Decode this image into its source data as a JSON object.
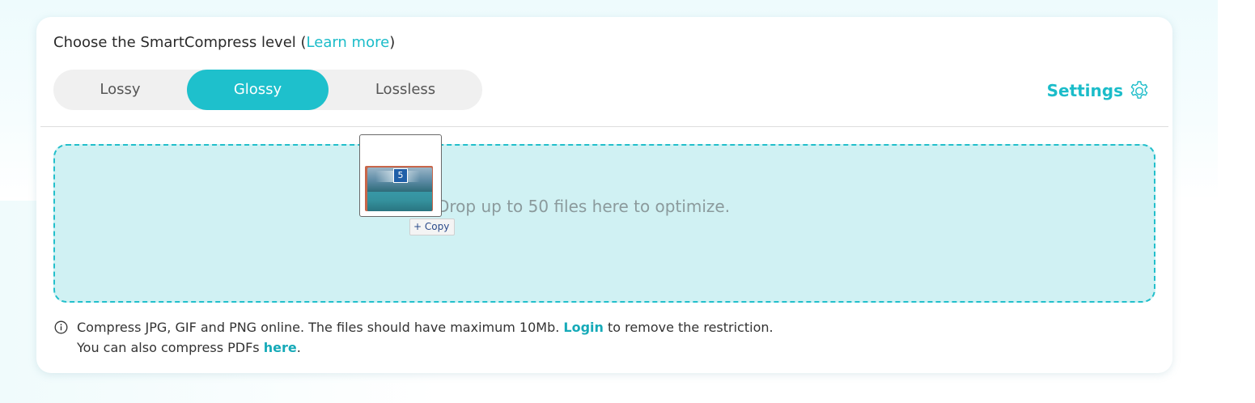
{
  "compress_level": {
    "title_prefix": "Choose the SmartCompress level (",
    "learn_more": "Learn more",
    "title_suffix": ")",
    "options": [
      {
        "label": "Lossy",
        "selected": false
      },
      {
        "label": "Glossy",
        "selected": true
      },
      {
        "label": "Lossless",
        "selected": false
      }
    ]
  },
  "settings": {
    "label": "Settings",
    "icon": "gear-icon"
  },
  "dropzone": {
    "text": "Drop up to 50 files here to optimize.",
    "drag_badge_count": "5",
    "copy_tooltip": "+ Copy"
  },
  "info": {
    "icon": "info-icon",
    "line1_before": "Compress JPG, GIF and PNG online. The files should have maximum 10Mb. ",
    "line1_link": "Login",
    "line1_after": " to remove the restriction.",
    "line2_before": "You can also compress PDFs ",
    "line2_link": "here",
    "line2_after": "."
  },
  "colors": {
    "accent": "#1ec0cc",
    "dropzone_bg": "#d0f1f3",
    "dropzone_border": "#22bfcb"
  }
}
